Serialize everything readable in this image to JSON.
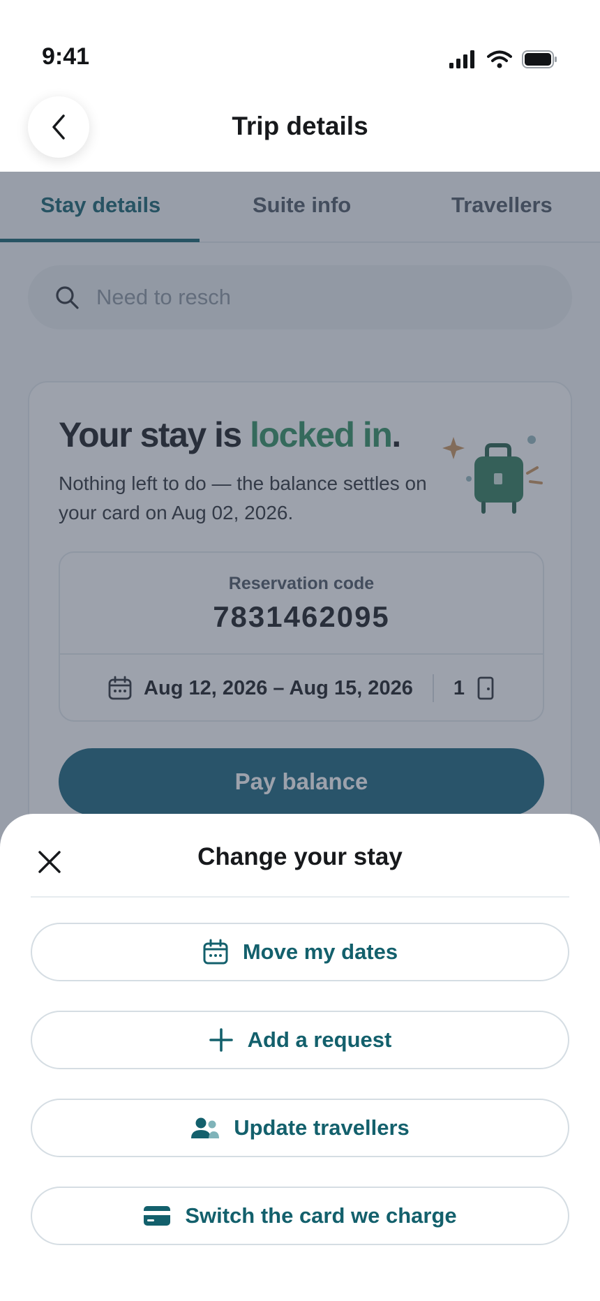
{
  "status_bar": {
    "time": "9:41"
  },
  "header": {
    "title": "Trip details"
  },
  "tabs": [
    {
      "label": "Stay details",
      "active": true
    },
    {
      "label": "Suite info",
      "active": false
    },
    {
      "label": "Travellers",
      "active": false
    }
  ],
  "search": {
    "value": "",
    "placeholder": "Need to resch"
  },
  "card": {
    "headline_pre": "Your stay is ",
    "headline_accent": "locked in",
    "headline_post": ".",
    "subtext": "Nothing left to do — the balance settles on your card on Aug 02, 2026.",
    "reservation_label": "Reservation code",
    "reservation_code": "7831462095",
    "dates": "Aug 12, 2026 – Aug 15, 2026",
    "rooms": "1",
    "pay_button": "Pay balance"
  },
  "sheet": {
    "title": "Change your stay",
    "options": [
      {
        "label": "Move my dates",
        "icon": "calendar-icon"
      },
      {
        "label": "Add a request",
        "icon": "plus-icon"
      },
      {
        "label": "Update travellers",
        "icon": "people-icon"
      },
      {
        "label": "Switch the card we charge",
        "icon": "credit-card-icon"
      }
    ]
  },
  "colors": {
    "accent": "#13606c",
    "success": "#2f8f5e",
    "button": "#17627a"
  }
}
